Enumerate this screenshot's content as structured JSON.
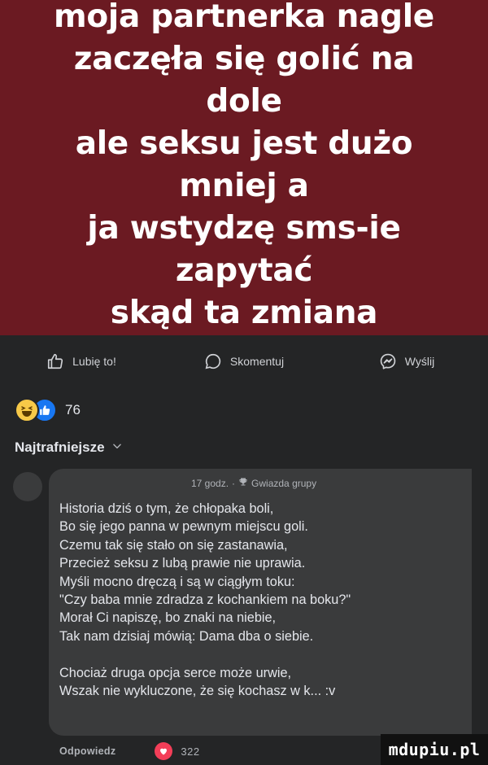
{
  "post": {
    "banner_text_lines": [
      "moja partnerka nagle",
      "zaczęła się golić na dole",
      "ale seksu jest dużo mniej a",
      "ja wstydzę sms-ie zapytać",
      "skąd ta zmiana"
    ],
    "banner_color": "#6b1a22"
  },
  "actions": {
    "like": "Lubię to!",
    "comment": "Skomentuj",
    "share": "Wyślij"
  },
  "reactions": {
    "count": "76",
    "types": [
      "haha-icon",
      "like-icon"
    ]
  },
  "sort": {
    "label": "Najtrafniejsze"
  },
  "comment": {
    "time": "17 godz.",
    "separator": "·",
    "badge": "Gwiazda grupy",
    "lines": [
      "Historia dziś o tym, że chłopaka boli,",
      "Bo się jego panna w pewnym miejscu goli.",
      "Czemu tak się stało on się zastanawia,",
      "Przecież seksu z lubą prawie nie uprawia.",
      "Myśli mocno dręczą i są w ciągłym toku:",
      "\"Czy baba mnie zdradza z kochankiem na boku?\"",
      "Morał Ci napiszę, bo znaki na niebie,",
      "Tak nam dzisiaj mówią: Dama dba o siebie.",
      "",
      "Chociaż druga opcja serce może urwie,",
      "Wszak nie wykluczone, że się kochasz w k... :v"
    ],
    "reply_label": "Odpowiedz",
    "reaction_count": "322"
  },
  "watermark": {
    "text": "mdupiu.pl"
  }
}
